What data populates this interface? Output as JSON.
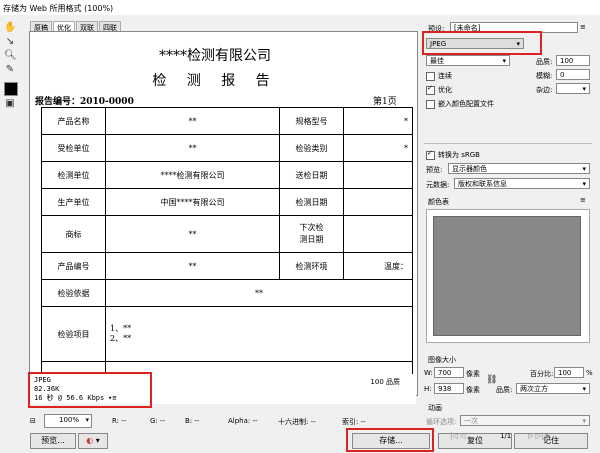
{
  "title": "存储为 Web 所用格式 (100%)",
  "tabs": [
    "原稿",
    "优化",
    "双联",
    "四联"
  ],
  "document": {
    "company": "****检测有限公司",
    "report_title": "检 测 报 告",
    "report_no": "报告编号：2010-0000",
    "page_no": "第1页",
    "rows": [
      [
        "产品名称",
        "**",
        "规格型号",
        "*"
      ],
      [
        "受检单位",
        "**",
        "检验类别",
        "*"
      ],
      [
        "检测单位",
        "****检测有限公司",
        "送检日期",
        ""
      ],
      [
        "生产单位",
        "中国****有限公司",
        "检测日期",
        ""
      ],
      [
        "商标",
        "**",
        "下次检\n测日期",
        ""
      ],
      [
        "产品编号",
        "**",
        "检测环境",
        "温度："
      ]
    ],
    "basis_label": "检验依据",
    "basis_value": "**",
    "items_label": "检验项目",
    "items_value": "1、**\n2、**"
  },
  "info": {
    "format": "JPEG",
    "size": "82.36K",
    "time": "16 秒 @ 56.6 Kbps",
    "quality": "100 品质"
  },
  "statusbar": {
    "zoom": "100%",
    "r": "R: --",
    "g": "G: --",
    "b": "B: --",
    "alpha": "Alpha: --",
    "hex": "十六进制: --",
    "index": "索引: --"
  },
  "buttons": {
    "preview": "预览...",
    "save": "存储...",
    "reset": "复位",
    "remember": "记住"
  },
  "settings": {
    "preset_label": "预设:",
    "preset_value": "[未命名]",
    "format": "JPEG",
    "quality_level": "最佳",
    "quality_label": "品质:",
    "quality_value": "100",
    "progressive": "连续",
    "blur_label": "模糊:",
    "blur_value": "0",
    "optimized": "优化",
    "matte_label": "杂边:",
    "embed_profile": "嵌入颜色配置文件",
    "convert_srgb": "转换为 sRGB",
    "preview_label": "预览:",
    "preview_value": "显示器颜色",
    "metadata_label": "元数据:",
    "metadata_value": "版权和联系信息",
    "color_table": "颜色表",
    "image_size": "图像大小",
    "w_label": "W:",
    "w_value": "700",
    "h_label": "H:",
    "h_value": "938",
    "unit": "像素",
    "percent_label": "百分比:",
    "percent_value": "100",
    "quality2_label": "品质:",
    "quality2_value": "两次立方",
    "animation": "动画",
    "loop_label": "循环选项:",
    "loop_value": "一次",
    "frame": "1/1"
  }
}
